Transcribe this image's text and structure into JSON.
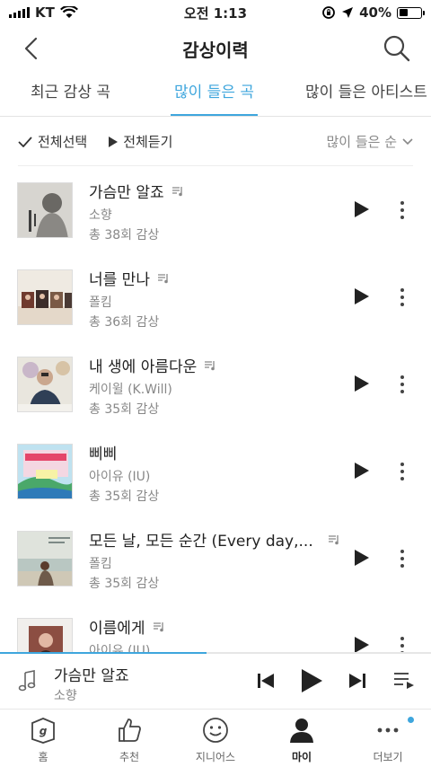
{
  "status_bar": {
    "carrier": "KT",
    "time": "오전 1:13",
    "battery": "40%",
    "battery_level": 0.4
  },
  "header": {
    "title": "감상이력"
  },
  "tabs": [
    {
      "label": "최근 감상 곡"
    },
    {
      "label": "많이 들은 곡",
      "active": true
    },
    {
      "label": "많이 들은 아티스트"
    }
  ],
  "toolbar": {
    "select_all": "전체선택",
    "play_all": "전체듣기",
    "sort": "많이 들은 순"
  },
  "songs": [
    {
      "title": "가슴만 알죠",
      "artist": "소향",
      "plays": "총 38회 감상",
      "thumb_icon": "album-cover-gray-portrait"
    },
    {
      "title": "너를 만나",
      "artist": "폴킴",
      "plays": "총 36회 감상",
      "thumb_icon": "album-cover-frames"
    },
    {
      "title": "내 생에 아름다운",
      "artist": "케이윌 (K.Will)",
      "plays": "총 35회 감상",
      "thumb_icon": "album-cover-man-flowers"
    },
    {
      "title": "삐삐",
      "artist": "아이유 (IU)",
      "plays": "총 35회 감상",
      "thumb_icon": "album-cover-colorful"
    },
    {
      "title": "모든 날, 모든 순간 (Every day,...",
      "artist": "폴킴",
      "plays": "총 35회 감상",
      "thumb_icon": "album-cover-seaside"
    },
    {
      "title": "이름에게",
      "artist": "아이유 (IU)",
      "plays": "",
      "thumb_icon": "album-cover-portrait"
    }
  ],
  "now_playing": {
    "title": "가슴만 알죠",
    "artist": "소향",
    "progress": 0.48
  },
  "bottom_nav": [
    {
      "label": "홈",
      "icon": "genie-home-icon"
    },
    {
      "label": "추천",
      "icon": "thumbs-up-icon"
    },
    {
      "label": "지니어스",
      "icon": "smiley-icon"
    },
    {
      "label": "마이",
      "icon": "person-icon",
      "active": true
    },
    {
      "label": "더보기",
      "icon": "more-dots-icon"
    }
  ],
  "colors": {
    "accent": "#3ea6dd",
    "text": "#222222",
    "subtext": "#888888"
  }
}
